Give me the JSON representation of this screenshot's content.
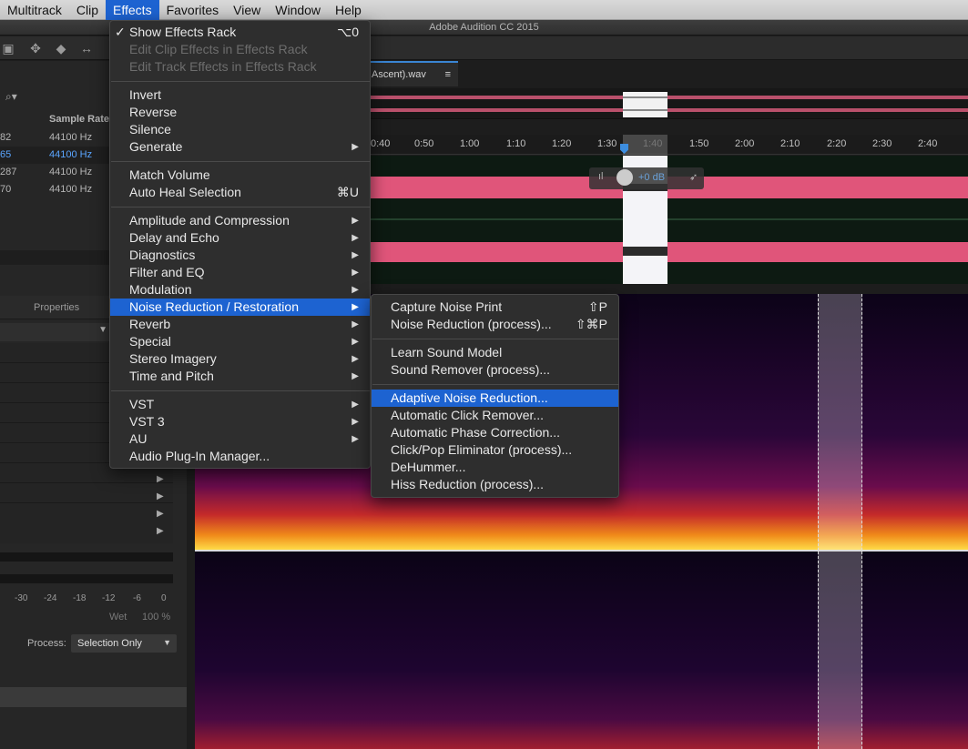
{
  "menubar": {
    "items": [
      "Multitrack",
      "Clip",
      "Effects",
      "Favorites",
      "View",
      "Window",
      "Help"
    ],
    "active": "Effects"
  },
  "window": {
    "title": "Adobe Audition CC 2015"
  },
  "file_tab": {
    "label": "Ascent).wav",
    "menu_icon": "≡"
  },
  "files": {
    "header": "Sample Rate",
    "rows": [
      {
        "num": "82",
        "rate": "44100 Hz"
      },
      {
        "num": "65",
        "rate": "44100 Hz"
      },
      {
        "num": "287",
        "rate": "44100 Hz"
      },
      {
        "num": "70",
        "rate": "44100 Hz"
      }
    ],
    "selected_index": 1
  },
  "left_bottom": {
    "properties_tab": "Properties",
    "meter_ticks": [
      "-30",
      "-24",
      "-18",
      "-12",
      "-6",
      "0"
    ],
    "wet_label": "Wet",
    "wet_value": "100 %",
    "process_label": "Process:",
    "process_value": "Selection Only"
  },
  "ruler": {
    "ticks": [
      "0:40",
      "0:50",
      "1:00",
      "1:10",
      "1:20",
      "1:30",
      "1:40",
      "1:50",
      "2:00",
      "2:10",
      "2:20",
      "2:30",
      "2:40"
    ]
  },
  "hud": {
    "gain": "+0 dB"
  },
  "effects_menu": {
    "groups": [
      [
        {
          "label": "Show Effects Rack",
          "shortcut": "⌥0",
          "checked": true
        },
        {
          "label": "Edit Clip Effects in Effects Rack",
          "disabled": true
        },
        {
          "label": "Edit Track Effects in Effects Rack",
          "disabled": true
        }
      ],
      [
        {
          "label": "Invert"
        },
        {
          "label": "Reverse"
        },
        {
          "label": "Silence"
        },
        {
          "label": "Generate",
          "submenu": true
        }
      ],
      [
        {
          "label": "Match Volume"
        },
        {
          "label": "Auto Heal Selection",
          "shortcut": "⌘U"
        }
      ],
      [
        {
          "label": "Amplitude and Compression",
          "submenu": true
        },
        {
          "label": "Delay and Echo",
          "submenu": true
        },
        {
          "label": "Diagnostics",
          "submenu": true
        },
        {
          "label": "Filter and EQ",
          "submenu": true
        },
        {
          "label": "Modulation",
          "submenu": true
        },
        {
          "label": "Noise Reduction / Restoration",
          "submenu": true,
          "highlighted": true
        },
        {
          "label": "Reverb",
          "submenu": true
        },
        {
          "label": "Special",
          "submenu": true
        },
        {
          "label": "Stereo Imagery",
          "submenu": true
        },
        {
          "label": "Time and Pitch",
          "submenu": true
        }
      ],
      [
        {
          "label": "VST",
          "submenu": true
        },
        {
          "label": "VST 3",
          "submenu": true
        },
        {
          "label": "AU",
          "submenu": true
        },
        {
          "label": "Audio Plug-In Manager..."
        }
      ]
    ]
  },
  "noise_submenu": {
    "groups": [
      [
        {
          "label": "Capture Noise Print",
          "shortcut": "⇧P"
        },
        {
          "label": "Noise Reduction (process)...",
          "shortcut": "⇧⌘P"
        }
      ],
      [
        {
          "label": "Learn Sound Model"
        },
        {
          "label": "Sound Remover (process)..."
        }
      ],
      [
        {
          "label": "Adaptive Noise Reduction...",
          "highlighted": true
        },
        {
          "label": "Automatic Click Remover..."
        },
        {
          "label": "Automatic Phase Correction..."
        },
        {
          "label": "Click/Pop Eliminator (process)..."
        },
        {
          "label": "DeHummer..."
        },
        {
          "label": "Hiss Reduction (process)..."
        }
      ]
    ]
  },
  "colors": {
    "accent": "#1d63d1",
    "waveform": "#e0557a",
    "selected_file": "#5aa5ff"
  }
}
